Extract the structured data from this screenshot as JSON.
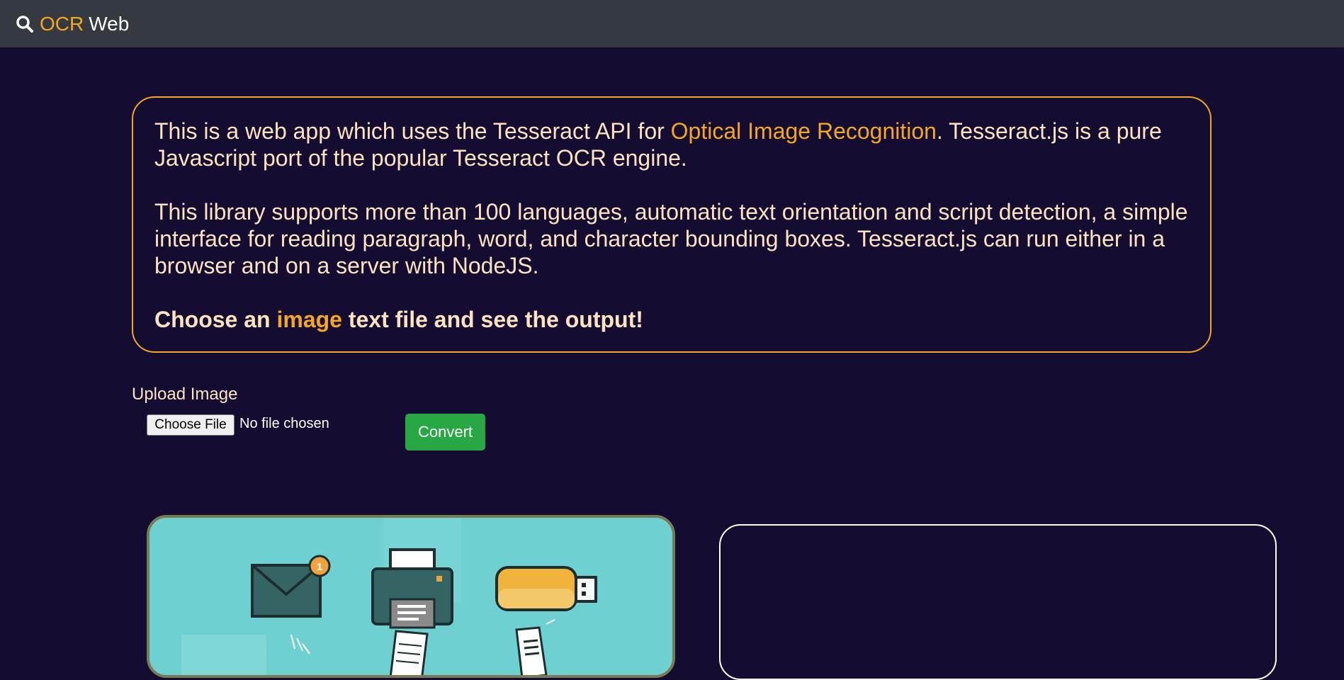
{
  "navbar": {
    "brand_accent": "OCR",
    "brand_rest": "Web",
    "icon": "search-icon"
  },
  "info": {
    "p1_a": "This is a web app which uses the Tesseract API for ",
    "p1_link": "Optical Image Recognition",
    "p1_b": ". Tesseract.js is a pure Javascript port of the popular Tesseract OCR engine.",
    "p2": "This library supports more than 100 languages, automatic text orientation and script detection, a simple interface for reading paragraph, word, and character bounding boxes. Tesseract.js can run either in a browser and on a server with NodeJS.",
    "cta_a": "Choose an ",
    "cta_hl": "image",
    "cta_b": " text file and see the output!"
  },
  "upload": {
    "label": "Upload Image",
    "choose_label": "Choose File",
    "status": "No file chosen",
    "convert_label": "Convert"
  },
  "colors": {
    "background": "#150d31",
    "navbar": "#343a40",
    "accent": "#f5a623",
    "text": "#fde3c0",
    "convert": "#28a745"
  }
}
